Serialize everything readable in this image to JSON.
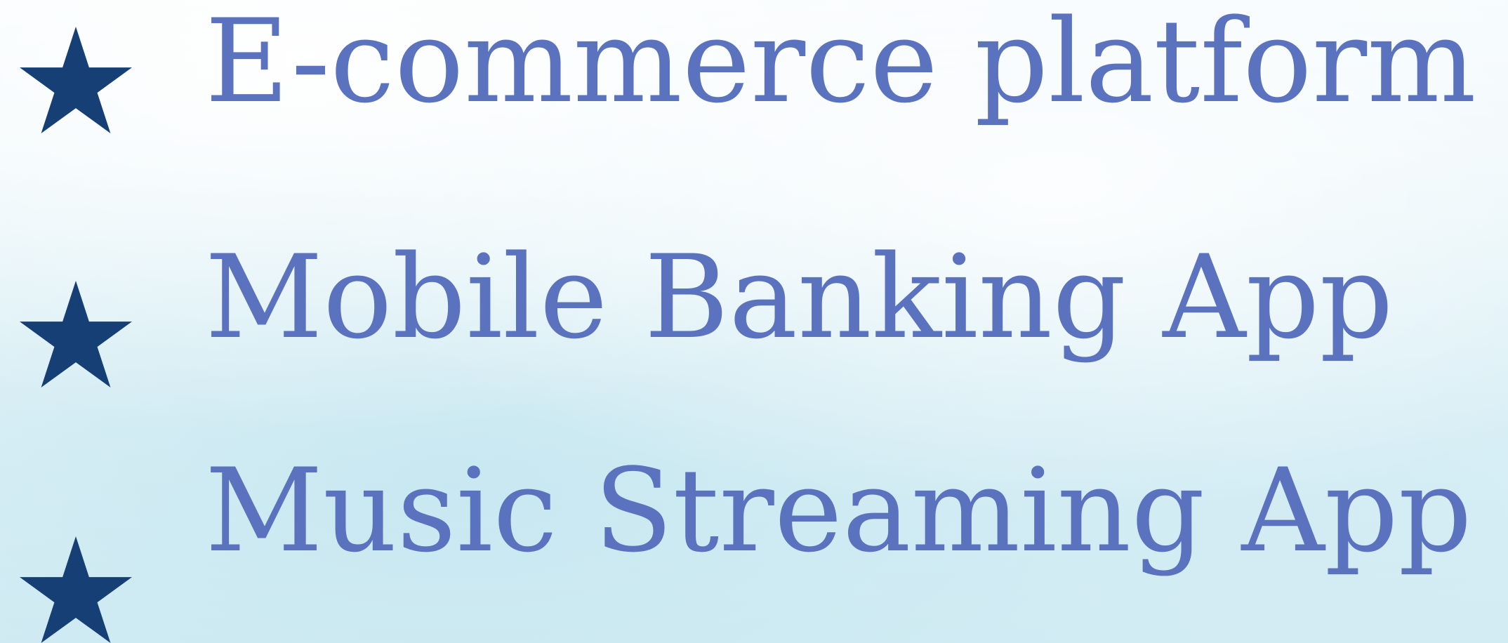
{
  "slide": {
    "bullets": [
      {
        "icon": "star-icon",
        "text": "E-commerce platform"
      },
      {
        "icon": "star-icon",
        "text": "Mobile Banking App"
      },
      {
        "icon": "star-icon",
        "text": "Music Streaming App"
      }
    ]
  },
  "colors": {
    "star": "#163f75",
    "text": "#5b73bf",
    "background": "#e6f4f8"
  }
}
